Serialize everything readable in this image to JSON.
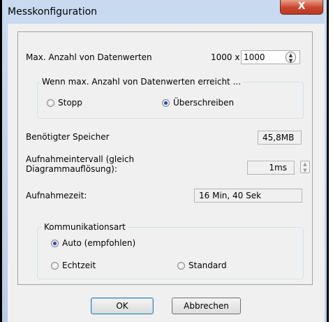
{
  "window": {
    "title": "Messkonfiguration",
    "close_glyph": "X"
  },
  "max_values": {
    "label": "Max. Anzahl von Datenwerten",
    "multiplier": "1000 x",
    "value": "1000"
  },
  "overflow_group": {
    "title": "Wenn max. Anzahl von Datenwerten erreicht ...",
    "options": [
      {
        "label": "Stopp",
        "checked": false
      },
      {
        "label": "Überschreiben",
        "checked": true
      }
    ]
  },
  "memory": {
    "label": "Benötigter Speicher",
    "value": "45,8MB"
  },
  "interval": {
    "label_line1": "Aufnahmeintervall (gleich",
    "label_line2": "Diagrammauflösung):",
    "value": "1ms"
  },
  "duration": {
    "label": "Aufnahmezeit:",
    "value": "16 Min, 40 Sek"
  },
  "communication_group": {
    "title": "Kommunikationsart",
    "options": [
      {
        "label": "Auto (empfohlen)",
        "checked": true
      },
      {
        "label": "Echtzeit",
        "checked": false
      },
      {
        "label": "Standard",
        "checked": false
      }
    ]
  },
  "buttons": {
    "ok": "OK",
    "cancel": "Abbrechen"
  },
  "colors": {
    "titlebar": "#c9daf0",
    "close": "#c8452e",
    "client": "#f0f0f0",
    "radio_dot": "#1e4fb0"
  }
}
